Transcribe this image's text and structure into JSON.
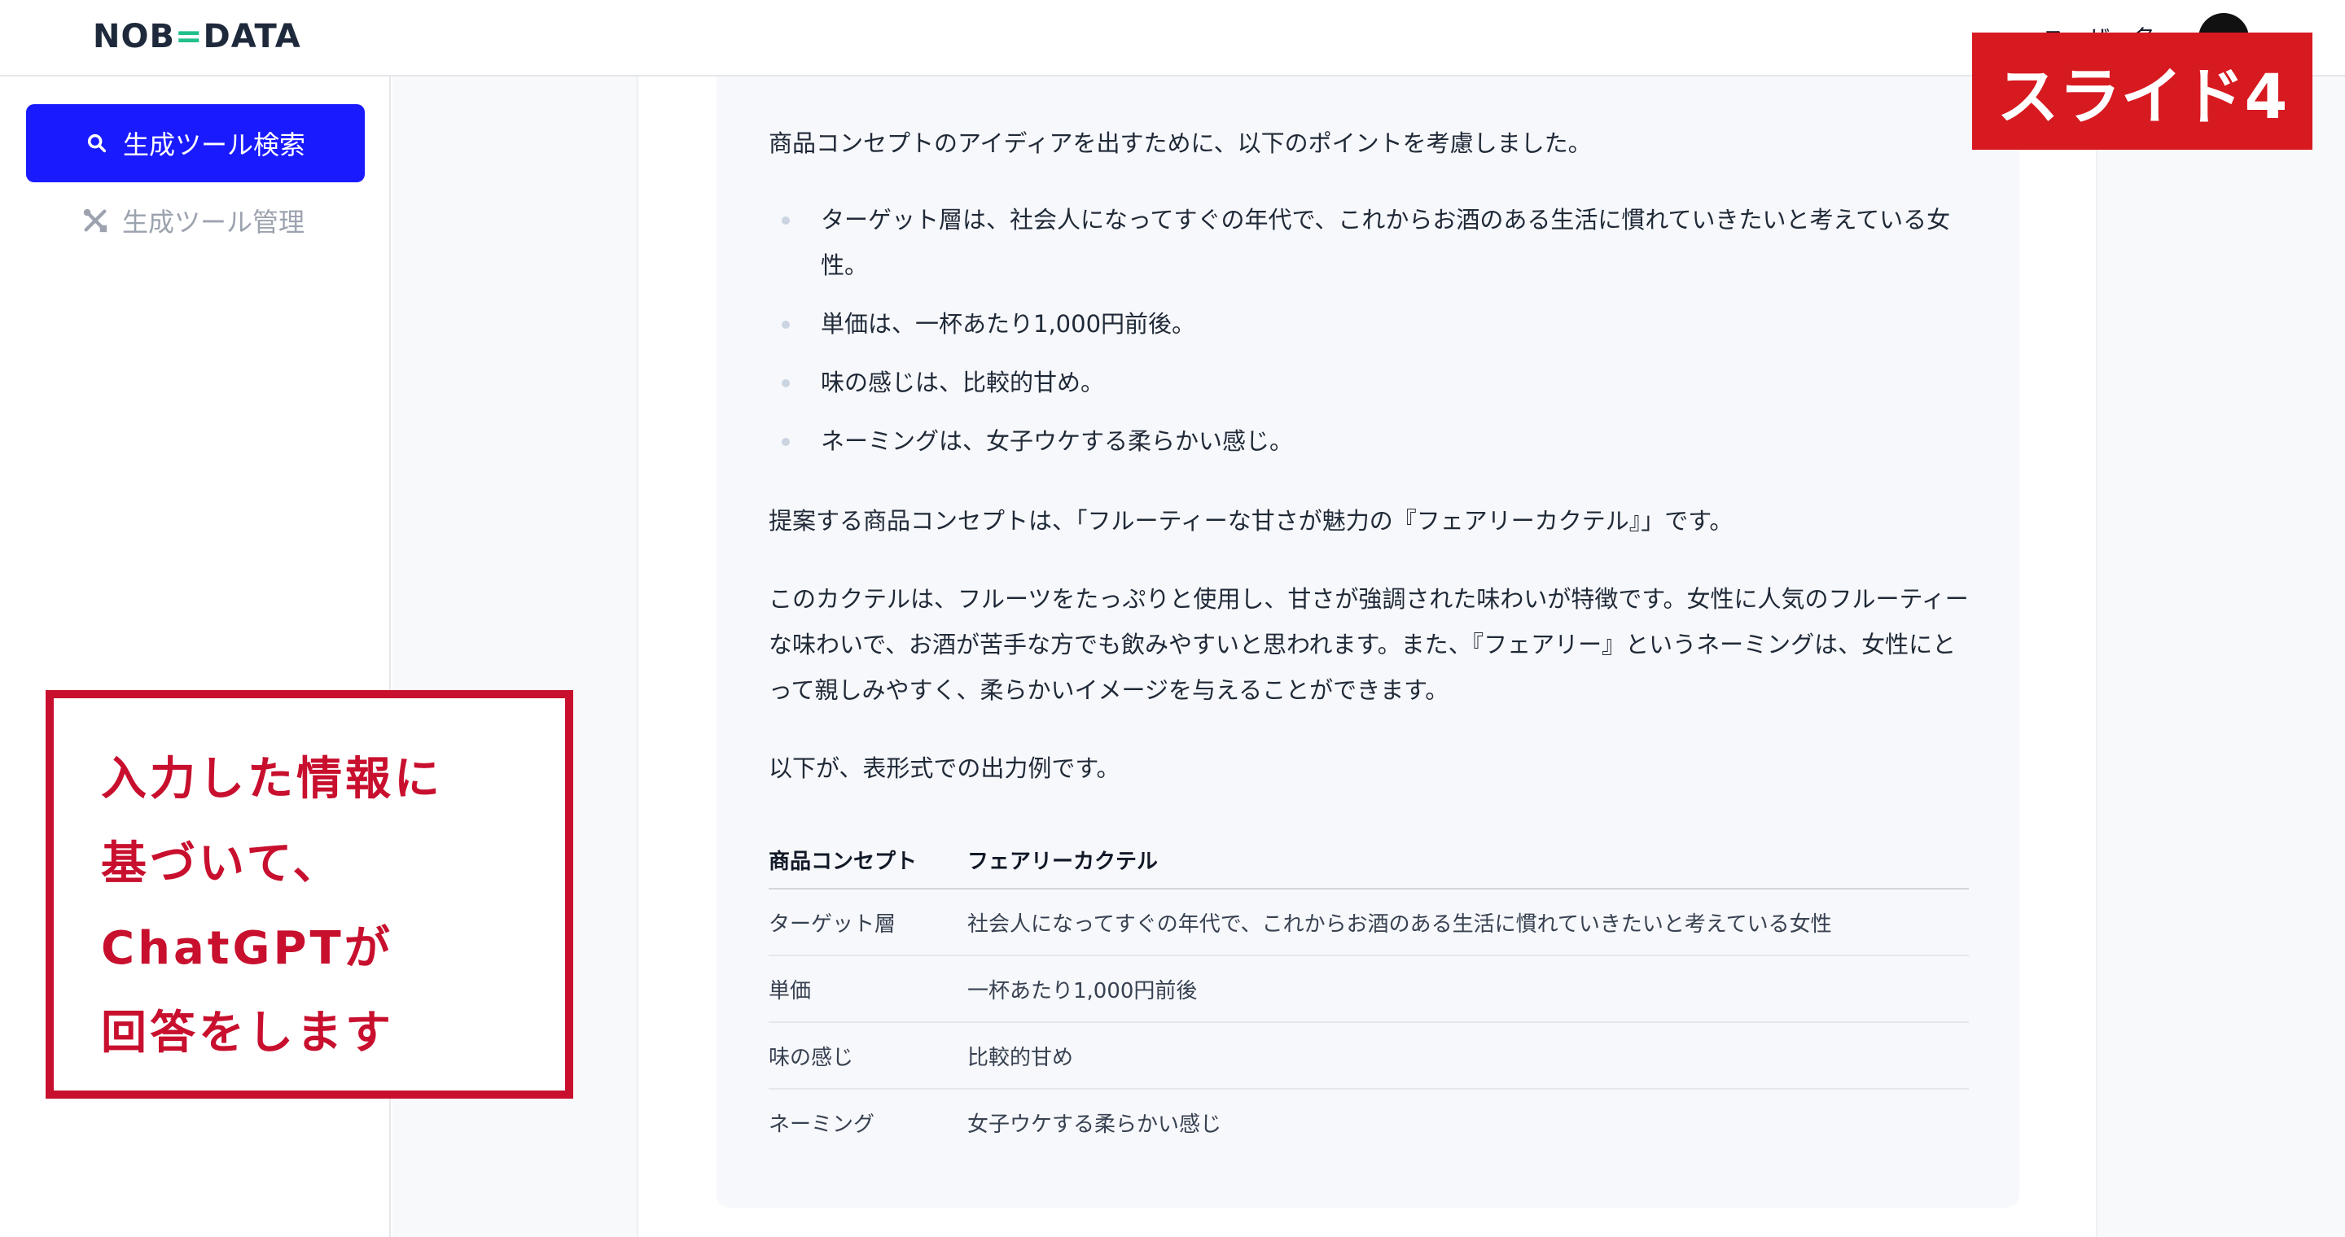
{
  "header": {
    "logo_left": "NOB",
    "logo_mid": "=",
    "logo_right": "DATA",
    "user_name": "ユーザー名"
  },
  "sidebar": {
    "search_button": "生成ツール検索",
    "manage_item": "生成ツール管理"
  },
  "slide_label": "スライド4",
  "answer": {
    "intro": "商品コンセプトのアイディアを出すために、以下のポイントを考慮しました。",
    "points": [
      "ターゲット層は、社会人になってすぐの年代で、これからお酒のある生活に慣れていきたいと考えている女性。",
      "単価は、一杯あたり1,000円前後。",
      "味の感じは、比較的甘め。",
      "ネーミングは、女子ウケする柔らかい感じ。"
    ],
    "proposal": "提案する商品コンセプトは、「フルーティーな甘さが魅力の『フェアリーカクテル』」です。",
    "description": "このカクテルは、フルーツをたっぷりと使用し、甘さが強調された味わいが特徴です。女性に人気のフルーティーな味わいで、お酒が苦手な方でも飲みやすいと思われます。また、『フェアリー』というネーミングは、女性にとって親しみやすく、柔らかいイメージを与えることができます。",
    "table_intro": "以下が、表形式での出力例です。",
    "table": {
      "header": [
        "商品コンセプト",
        "フェアリーカクテル"
      ],
      "rows": [
        [
          "ターゲット層",
          "社会人になってすぐの年代で、これからお酒のある生活に慣れていきたいと考えている女性"
        ],
        [
          "単価",
          "一杯あたり1,000円前後"
        ],
        [
          "味の感じ",
          "比較的甘め"
        ],
        [
          "ネーミング",
          "女子ウケする柔らかい感じ"
        ]
      ]
    }
  },
  "annotation": {
    "lines": [
      "入力した情報に",
      "基づいて、",
      "ChatGPTが",
      "回答をします"
    ]
  },
  "colors": {
    "accent_blue": "#1a1aff",
    "slide_red": "#d71920",
    "annotation_red": "#c8102e"
  }
}
